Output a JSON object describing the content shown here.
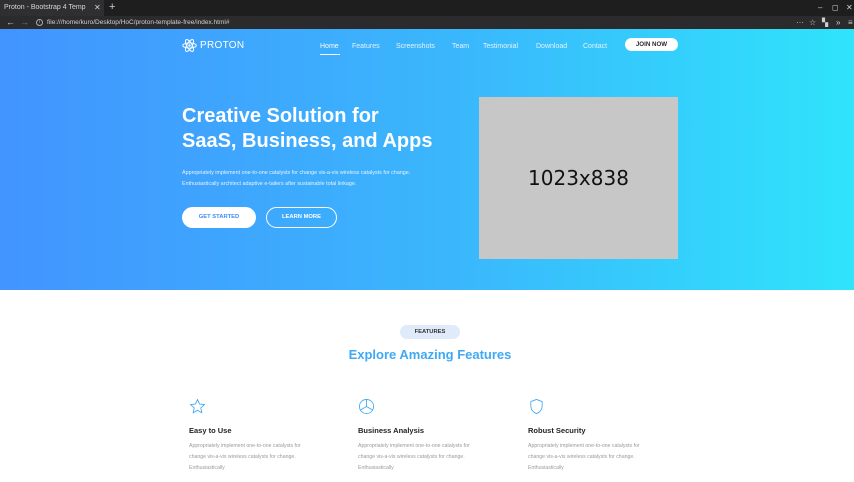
{
  "browser": {
    "tab_title": "Proton - Bootstrap 4 Temp",
    "tab_close": "✕",
    "new_tab": "+",
    "url": "file:///home/kuro/Desktop/HoC/proton-template-free/index.html#",
    "back": "←",
    "forward": "→",
    "overflow": "···",
    "extensions": "»",
    "menu": "≡"
  },
  "navbar": {
    "brand": "PROTON",
    "items": [
      "Home",
      "Features",
      "Screenshots",
      "Team",
      "Testimonial",
      "Download",
      "Contact"
    ],
    "cta": "JOIN NOW"
  },
  "hero": {
    "title_line1": "Creative Solution for",
    "title_line2": "SaaS, Business, and Apps",
    "desc_line1": "Appropriately implement one-to-one catalysts for change vis-a-vis wireless catalysts for change.",
    "desc_line2": "Enthusiastically architect adaptive e-tailers after sustainable total linkage.",
    "btn_primary": "GET STARTED",
    "btn_secondary": "LEARN MORE",
    "image_placeholder": "1023x838"
  },
  "features": {
    "badge": "FEATURES",
    "title": "Explore Amazing Features",
    "cards": [
      {
        "icon": "star-icon",
        "title": "Easy to Use",
        "desc_line1": "Appropriately implement one-to-one catalysts for",
        "desc_line2": "change vis-a-vis wireless catalysts for change.",
        "desc_line3": "Enthusiastically"
      },
      {
        "icon": "pie-chart-icon",
        "title": "Business Analysis",
        "desc_line1": "Appropriately implement one-to-one catalysts for",
        "desc_line2": "change vis-a-vis wireless catalysts for change.",
        "desc_line3": "Enthusiastically"
      },
      {
        "icon": "shield-icon",
        "title": "Robust Security",
        "desc_line1": "Appropriately implement one-to-one catalysts for",
        "desc_line2": "change vis-a-vis wireless catalysts for change.",
        "desc_line3": "Enthusiastically"
      }
    ]
  },
  "colors": {
    "hero_gradient_start": "#4294ff",
    "hero_gradient_end": "#2fe4fb",
    "accent": "#3fa9f5"
  }
}
